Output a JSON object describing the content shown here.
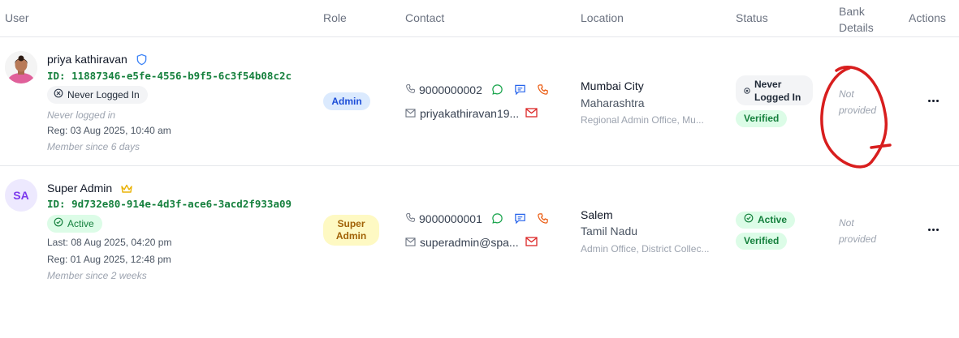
{
  "headers": {
    "user": "User",
    "role": "Role",
    "contact": "Contact",
    "location": "Location",
    "status": "Status",
    "bank_line1": "Bank",
    "bank_line2": "Details",
    "actions": "Actions"
  },
  "rows": [
    {
      "name": "priya kathiravan",
      "name_icon": "shield-icon",
      "id": "ID: 11887346-e5fe-4556-b9f5-6c3f54b08c2c",
      "login_badge": "Never Logged In",
      "meta1": "Never logged in",
      "meta2": "Reg: 03 Aug 2025, 10:40 am",
      "meta3": "Member since 6 days",
      "role": "Admin",
      "phone": "9000000002",
      "email": "priyakathiravan19...",
      "city": "Mumbai City",
      "state": "Maharashtra",
      "office": "Regional Admin Office, Mu...",
      "status_line1": "Never",
      "status_line2": "Logged In",
      "verified": "Verified",
      "bank_line1": "Not",
      "bank_line2": "provided"
    },
    {
      "name": "Super Admin",
      "name_icon": "crown-icon",
      "initials": "SA",
      "id": "ID: 9d732e80-914e-4d3f-ace6-3acd2f933a09",
      "login_badge": "Active",
      "meta1": "Last: 08 Aug 2025, 04:20 pm",
      "meta2": "Reg: 01 Aug 2025, 12:48 pm",
      "meta3": "Member since 2 weeks",
      "role_line1": "Super",
      "role_line2": "Admin",
      "phone": "9000000001",
      "email": "superadmin@spa...",
      "city": "Salem",
      "state": "Tamil Nadu",
      "office": "Admin Office, District Collec...",
      "status": "Active",
      "verified": "Verified",
      "bank_line1": "Not",
      "bank_line2": "provided"
    }
  ],
  "colors": {
    "admin_blue": "#1d4ed8",
    "verified_green": "#15803d",
    "super_yellow": "#a16207",
    "annotation_red": "#d81e1e"
  },
  "icons": [
    "shield-icon",
    "crown-icon",
    "phone-icon",
    "whatsapp-icon",
    "message-icon",
    "call-icon",
    "mail-icon",
    "more-icon"
  ]
}
